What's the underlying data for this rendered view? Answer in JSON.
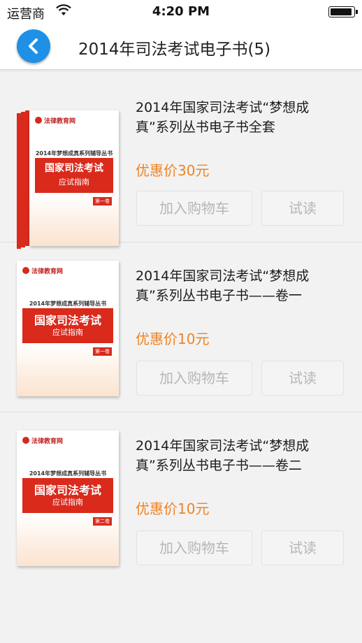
{
  "status_bar": {
    "carrier": "运营商",
    "time": "4:20 PM"
  },
  "nav": {
    "title": "2014年司法考试电子书(5)",
    "back_icon": "chevron-left-icon"
  },
  "buttons": {
    "add_to_cart": "加入购物车",
    "trial_read": "试读"
  },
  "books": [
    {
      "title_line1": "2014年国家司法考试“梦想成",
      "title_line2": "真”系列丛书电子书全套",
      "price": "优惠价30元"
    },
    {
      "title_line1": "2014年国家司法考试“梦想成",
      "title_line2": "真”系列丛书电子书——卷一",
      "price": "优惠价10元"
    },
    {
      "title_line1": "2014年国家司法考试“梦想成",
      "title_line2": "真”系列丛书电子书——卷二",
      "price": "优惠价10元"
    }
  ],
  "cover": {
    "publisher": "法律教育网",
    "series": "2014年梦想成真系列辅导丛书",
    "title": "国家司法考试",
    "subtitle": "应试指南",
    "volumes": [
      "第一卷",
      "第一卷",
      "第二卷"
    ]
  },
  "colors": {
    "accent": "#1e90e6",
    "price": "#f08323",
    "cover_red": "#d92a1c"
  }
}
